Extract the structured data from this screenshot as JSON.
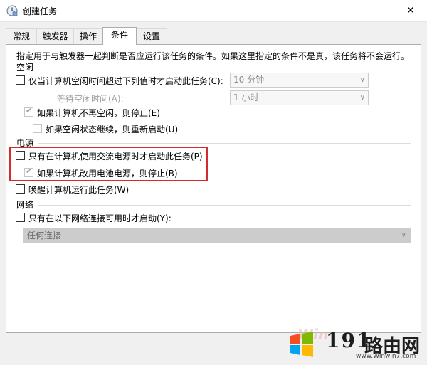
{
  "window": {
    "title": "创建任务",
    "close_glyph": "✕"
  },
  "tabs": [
    {
      "label": "常规",
      "active": false
    },
    {
      "label": "触发器",
      "active": false
    },
    {
      "label": "操作",
      "active": false
    },
    {
      "label": "条件",
      "active": true
    },
    {
      "label": "设置",
      "active": false
    }
  ],
  "description": "指定用于与触发器一起判断是否应运行该任务的条件。如果这里指定的条件不是真，该任务将不会运行。",
  "idle": {
    "group_label": "空闲",
    "start_idle_label": "仅当计算机空闲时间超过下列值时才启动此任务(C):",
    "idle_duration_value": "10 分钟",
    "wait_idle_label": "等待空闲时间(A):",
    "wait_idle_value": "1 小时",
    "stop_on_idle_end_label": "如果计算机不再空闲，则停止(E)",
    "restart_on_idle_label": "如果空闲状态继续，则重新启动(U)"
  },
  "power": {
    "group_label": "电源",
    "ac_only_label": "只有在计算机使用交流电源时才启动此任务(P)",
    "stop_on_battery_label": "如果计算机改用电池电源，则停止(B)",
    "wake_label": "唤醒计算机运行此任务(W)"
  },
  "network": {
    "group_label": "网络",
    "network_only_label": "只有在以下网络连接可用时才启动(Y):",
    "connection_value": "任何连接"
  },
  "watermark": {
    "number": "191",
    "brand": "路由网",
    "url": "www.Winwin7.com",
    "faint_text": "Win"
  },
  "colors": {
    "highlight_border": "#d62b2b",
    "panel_border": "#adadad"
  },
  "icons": {
    "window": "task-scheduler-icon",
    "close": "close-icon",
    "dropdown": "chevron-down-icon",
    "checkmark": "checkmark-icon"
  }
}
